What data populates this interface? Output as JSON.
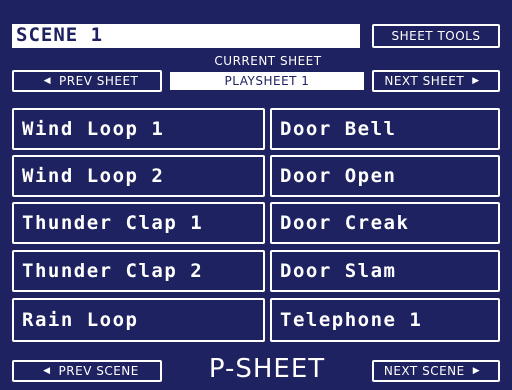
{
  "header": {
    "scene_title": "SCENE 1",
    "sheet_tools_label": "SHEET TOOLS"
  },
  "sheet_nav": {
    "current_sheet_label": "CURRENT SHEET",
    "current_sheet_name": "PLAYSHEET 1",
    "prev_label": "PREV SHEET",
    "next_label": "NEXT SHEET"
  },
  "sounds": [
    {
      "label": "Wind Loop 1"
    },
    {
      "label": "Door Bell"
    },
    {
      "label": "Wind Loop 2"
    },
    {
      "label": "Door Open"
    },
    {
      "label": "Thunder Clap 1"
    },
    {
      "label": "Door Creak"
    },
    {
      "label": "Thunder Clap 2"
    },
    {
      "label": "Door Slam"
    },
    {
      "label": "Rain Loop"
    },
    {
      "label": "Telephone 1"
    }
  ],
  "footer": {
    "prev_scene_label": "PREV SCENE",
    "next_scene_label": "NEXT SCENE",
    "mode_label": "P-SHEET"
  },
  "colors": {
    "background": "#1f2260",
    "foreground": "#ffffff"
  },
  "icons": {
    "left_arrow": "left-triangle",
    "right_arrow": "right-triangle"
  }
}
